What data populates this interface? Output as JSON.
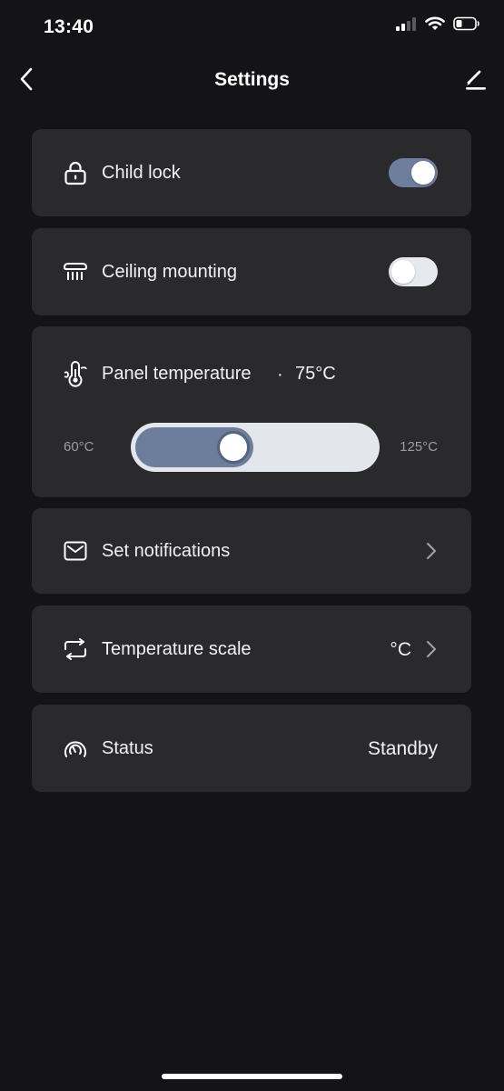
{
  "status_bar": {
    "time": "13:40",
    "icons": [
      "signal-icon",
      "wifi-icon",
      "battery-icon"
    ]
  },
  "header": {
    "title": "Settings",
    "back_icon": "chevron-left-icon",
    "edit_icon": "pencil-icon"
  },
  "settings": {
    "child_lock": {
      "label": "Child lock",
      "icon": "lock-icon",
      "enabled": true
    },
    "ceiling_mounting": {
      "label": "Ceiling mounting",
      "icon": "ceiling-heater-icon",
      "enabled": false
    },
    "panel_temperature": {
      "label": "Panel temperature",
      "separator": "·",
      "value": "75°C",
      "icon": "thermometer-icon",
      "min_label": "60°C",
      "max_label": "125°C",
      "min": 60,
      "max": 125,
      "current": 75
    },
    "notifications": {
      "label": "Set notifications",
      "icon": "envelope-icon"
    },
    "temperature_scale": {
      "label": "Temperature scale",
      "value": "°C",
      "icon": "swap-icon"
    },
    "status": {
      "label": "Status",
      "value": "Standby",
      "icon": "gauge-icon"
    }
  },
  "colors": {
    "background": "#141416",
    "card": "#2a2a2d",
    "accent": "#6d7f9c",
    "toggle_off": "#e6e9ee",
    "muted_text": "#9a9ca3"
  }
}
